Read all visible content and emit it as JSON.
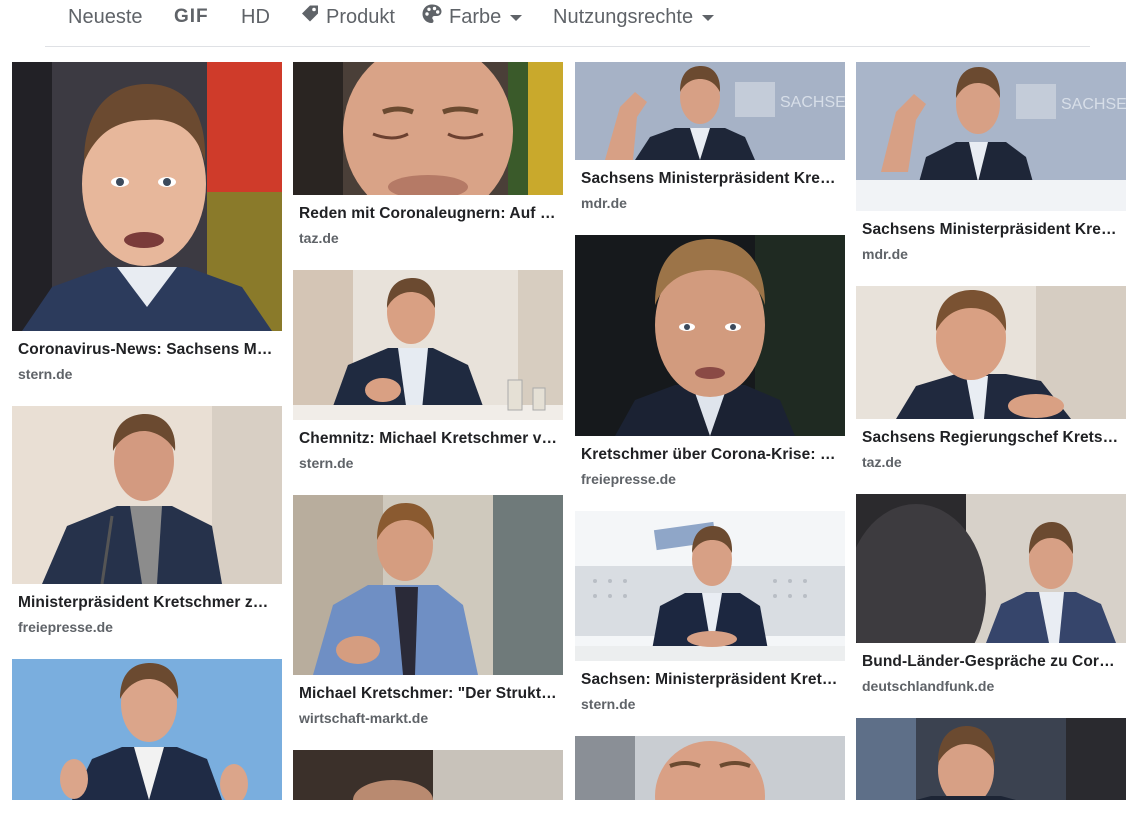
{
  "toolbar": {
    "items": [
      {
        "label": "Neueste",
        "icon": ""
      },
      {
        "label": "GIF",
        "icon": ""
      },
      {
        "label": "HD",
        "icon": ""
      },
      {
        "label": "Produkt",
        "icon": "tag-icon"
      },
      {
        "label": "Farbe",
        "icon": "palette-icon"
      },
      {
        "label": "Nutzungsrechte",
        "icon": ""
      }
    ]
  },
  "results": [
    {
      "title": "Coronavirus-News: Sachsens Min…",
      "source": "stern.de"
    },
    {
      "title": "Ministerpräsident Kretschmer zur…",
      "source": "freiepresse.de"
    },
    {
      "title": "",
      "source": ""
    },
    {
      "title": "Reden mit Coronaleugnern: Auf d…",
      "source": "taz.de"
    },
    {
      "title": "Chemnitz: Michael Kretschmer ve…",
      "source": "stern.de"
    },
    {
      "title": "Michael Kretschmer: \"Der Struktur…",
      "source": "wirtschaft-markt.de"
    },
    {
      "title": "",
      "source": ""
    },
    {
      "title": "Sachsens Ministerpräsident Krets…",
      "source": "mdr.de"
    },
    {
      "title": "Kretschmer über Corona-Krise: \"…",
      "source": "freiepresse.de"
    },
    {
      "title": "Sachsen: Ministerpräsident Krets…",
      "source": "stern.de"
    },
    {
      "title": "",
      "source": ""
    },
    {
      "title": "Sachsens Ministerpräsident Krets…",
      "source": "mdr.de"
    },
    {
      "title": "Sachsens Regierungschef Kretsc…",
      "source": "taz.de"
    },
    {
      "title": "Bund-Länder-Gespräche zu Coron…",
      "source": "deutschlandfunk.de"
    },
    {
      "title": "",
      "source": ""
    }
  ],
  "colors": {
    "tool_text": "#5f6368",
    "title_text": "#202124",
    "source_text": "#5f6368",
    "divider": "#dfe1e5"
  }
}
